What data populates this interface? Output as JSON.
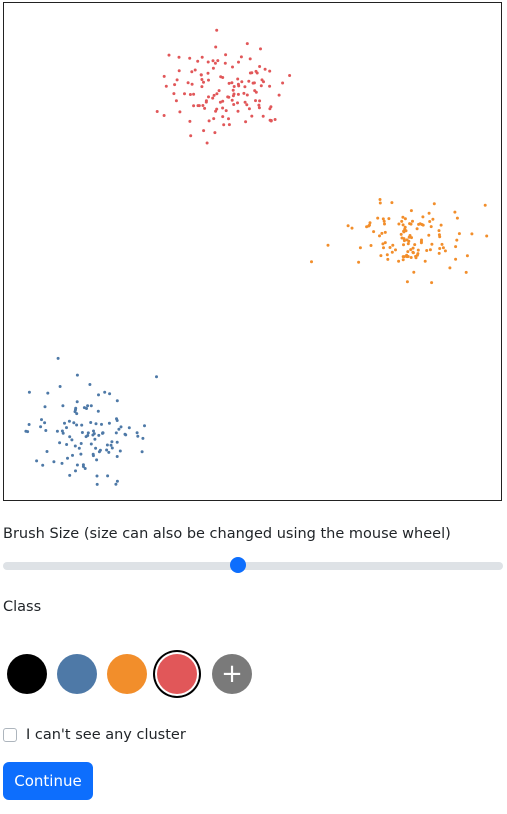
{
  "canvas": {
    "clusters": [
      {
        "name": "red",
        "color": "#e15759"
      },
      {
        "name": "orange",
        "color": "#f28e2b"
      },
      {
        "name": "blue",
        "color": "#4e79a7"
      }
    ]
  },
  "brush": {
    "label": "Brush Size (size can also be changed using the mouse wheel)",
    "value_fraction": 0.47
  },
  "class_section": {
    "label": "Class",
    "swatches": [
      {
        "name": "black",
        "color": "#000000",
        "selected": false
      },
      {
        "name": "blue",
        "color": "#4e79a7",
        "selected": false
      },
      {
        "name": "orange",
        "color": "#f28e2b",
        "selected": false
      },
      {
        "name": "red",
        "color": "#e15759",
        "selected": true
      }
    ],
    "add_symbol": "+"
  },
  "no_cluster": {
    "label": "I can't see any cluster",
    "checked": false
  },
  "continue_button": {
    "label": "Continue"
  },
  "colors": {
    "accent": "#0d6efd",
    "track": "#dee2e6",
    "add_button": "#7a7a7a"
  }
}
